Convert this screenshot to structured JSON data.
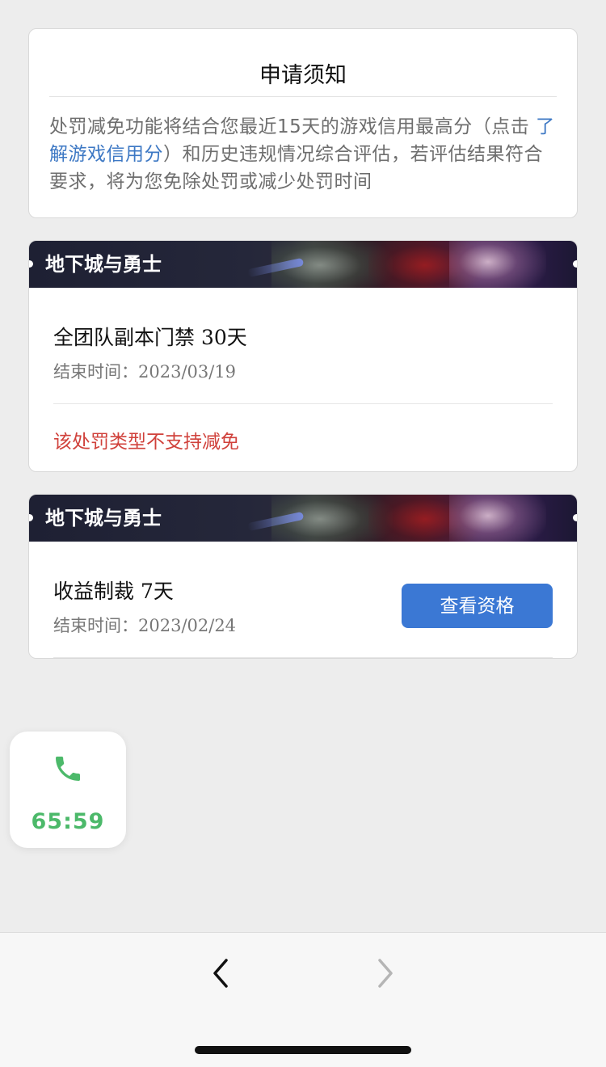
{
  "notice": {
    "title": "申请须知",
    "body_before_link": "处罚减免功能将结合您最近15天的游戏信用最高分（点击 ",
    "link_text": "了解游戏信用分",
    "body_after_link": "）和历史违规情况综合评估，若评估结果符合要求，将为您免除处罚或减少处罚时间"
  },
  "penalties": [
    {
      "game": "地下城与勇士",
      "name": "全团队副本门禁 30天",
      "end_label": "结束时间：",
      "end_date": "2023/03/19",
      "note": "该处罚类型不支持减免"
    },
    {
      "game": "地下城与勇士",
      "name": "收益制裁 7天",
      "end_label": "结束时间：",
      "end_date": "2023/02/24",
      "button": "查看资格"
    }
  ],
  "call_widget": {
    "timer": "65:59",
    "icon": "phone-icon"
  },
  "bottom_bar": {
    "back_icon": "chevron-left-icon",
    "forward_icon": "chevron-right-icon"
  },
  "colors": {
    "link": "#3d78c4",
    "warning": "#d0413b",
    "button": "#3b78d4",
    "call_green": "#4cb96a"
  }
}
